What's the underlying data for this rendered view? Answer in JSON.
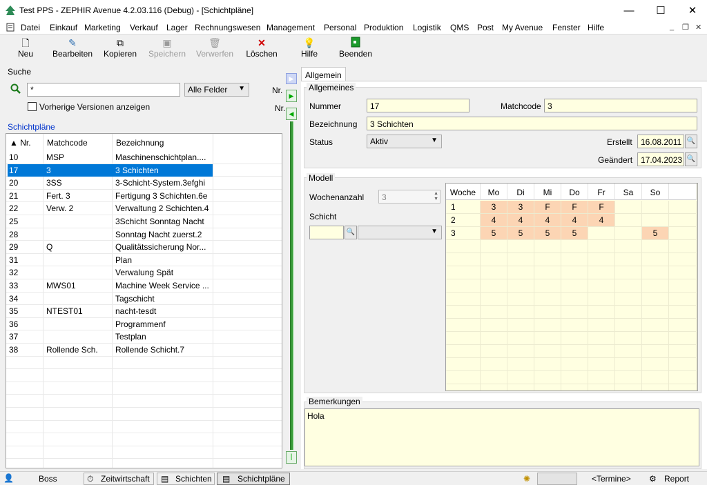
{
  "window": {
    "title": "Test PPS - ZEPHIR Avenue 4.2.03.116 (Debug) - [Schichtpläne]",
    "minimize": "—",
    "maximize": "☐",
    "close": "✕"
  },
  "menu": [
    "Datei",
    "Einkauf",
    "Marketing",
    "Verkauf",
    "Lager",
    "Rechnungswesen",
    "Management",
    "Personal",
    "Produktion",
    "Logistik",
    "QMS",
    "Post",
    "My Avenue",
    "Fenster",
    "Hilfe"
  ],
  "toolbar": {
    "new": "Neu",
    "edit": "Bearbeiten",
    "copy": "Kopieren",
    "save": "Speichern",
    "discard": "Verwerfen",
    "delete": "Löschen",
    "help": "Hilfe",
    "exit": "Beenden"
  },
  "search": {
    "title": "Suche",
    "value": "*",
    "field_select": "Alle Felder",
    "prev_versions": "Vorherige Versionen anzeigen",
    "nr_label1": "Nr.",
    "nr_label2": "Nr."
  },
  "list": {
    "title": "Schichtpläne",
    "headers": [
      "▲ Nr.",
      "Matchcode",
      "Bezeichnung"
    ],
    "rows": [
      [
        "10",
        "MSP",
        "Maschinenschichtplan...."
      ],
      [
        "17",
        "3",
        "3 Schichten"
      ],
      [
        "20",
        "3SS",
        "3-Schicht-System.3efghi"
      ],
      [
        "21",
        "Fert. 3",
        "Fertigung 3 Schichten.6e"
      ],
      [
        "22",
        "Verw. 2",
        "Verwaltung 2 Schichten.4"
      ],
      [
        "25",
        "",
        "3Schicht Sonntag Nacht"
      ],
      [
        "28",
        "",
        "Sonntag Nacht zuerst.2"
      ],
      [
        "29",
        "Q",
        "Qualitätssicherung Nor..."
      ],
      [
        "31",
        "",
        "Plan"
      ],
      [
        "32",
        "",
        "Verwalung Spät"
      ],
      [
        "33",
        "MWS01",
        "Machine Week Service ..."
      ],
      [
        "34",
        "",
        "Tagschicht"
      ],
      [
        "35",
        "NTEST01",
        "nacht-tesdt"
      ],
      [
        "36",
        "",
        "Programmenf"
      ],
      [
        "37",
        "",
        "Testplan"
      ],
      [
        "38",
        "Rollende Sch.",
        "Rollende Schicht.7"
      ]
    ],
    "selected_index": 1
  },
  "tab": "Allgemein",
  "general": {
    "title": "Allgemeines",
    "nummer_label": "Nummer",
    "nummer": "17",
    "matchcode_label": "Matchcode",
    "matchcode": "3",
    "bezeichnung_label": "Bezeichnung",
    "bezeichnung": "3 Schichten",
    "status_label": "Status",
    "status": "Aktiv",
    "erstellt_label": "Erstellt",
    "erstellt": "16.08.2011",
    "geaendert_label": "Geändert",
    "geaendert": "17.04.2023"
  },
  "model": {
    "title": "Modell",
    "wochenanzahl_label": "Wochenanzahl",
    "wochenanzahl": "3",
    "schicht_label": "Schicht",
    "grid_headers": [
      "Woche",
      "Mo",
      "Di",
      "Mi",
      "Do",
      "Fr",
      "Sa",
      "So"
    ],
    "grid_rows": [
      [
        "1",
        "3",
        "3",
        "F",
        "F",
        "F",
        "",
        ""
      ],
      [
        "2",
        "4",
        "4",
        "4",
        "4",
        "4",
        "",
        ""
      ],
      [
        "3",
        "5",
        "5",
        "5",
        "5",
        "",
        "",
        "5"
      ]
    ]
  },
  "remarks": {
    "title": "Bemerkungen",
    "text": "Hola"
  },
  "statusbar": {
    "user": "Boss",
    "tab1": "Zeitwirtschaft",
    "tab2": "Schichten",
    "tab3": "Schichtpläne",
    "termine": "<Termine>",
    "report": "Report"
  },
  "colors": {
    "selection": "#0078d7",
    "highlight_cell": "#fcd5b4",
    "input_bg": "#ffffe1",
    "splitter": "#3a9a3a"
  }
}
